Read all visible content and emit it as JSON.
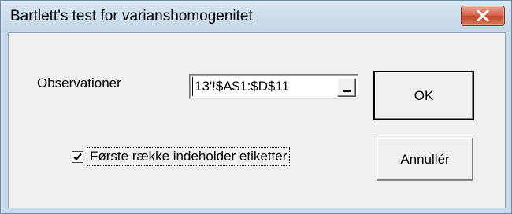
{
  "window": {
    "title": "Bartlett's test for varianshomogenitet",
    "close_icon": "close-icon",
    "close_color": "#c9452d"
  },
  "form": {
    "observations_label": "Observationer",
    "observations_value": "13'!$A$1:$D$11",
    "collapse_icon": "collapse-dialog-icon",
    "first_row_labels": {
      "label": "Første række indeholder etiketter",
      "checked": true
    }
  },
  "buttons": {
    "ok_label": "OK",
    "cancel_label": "Annullér"
  }
}
